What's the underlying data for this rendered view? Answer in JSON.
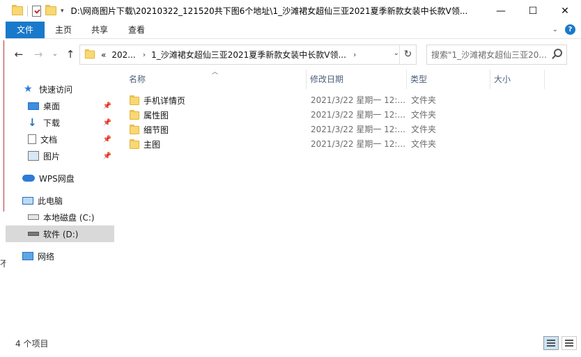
{
  "window": {
    "title_path": "D:\\网商图片下载\\20210322_121520共下图6个地址\\1_沙滩裙女超仙三亚2021夏季新款女装中长款V领...",
    "controls": {
      "minimize": "—",
      "maximize": "☐",
      "close": "✕"
    }
  },
  "ribbon": {
    "tabs": [
      "文件",
      "主页",
      "共享",
      "查看"
    ]
  },
  "address": {
    "overflow": "«",
    "crumb1": "202...",
    "crumb2": "1_沙滩裙女超仙三亚2021夏季新款女装中长款V领...",
    "sep": "›"
  },
  "search": {
    "placeholder": "搜索\"1_沙滩裙女超仙三亚20..."
  },
  "nav": {
    "quick_access": "快速访问",
    "items": [
      {
        "label": "桌面",
        "icon": "desktop-icon"
      },
      {
        "label": "下载",
        "icon": "download-icon"
      },
      {
        "label": "文档",
        "icon": "documents-icon"
      },
      {
        "label": "图片",
        "icon": "pictures-icon"
      }
    ],
    "wps": "WPS网盘",
    "this_pc": "此电脑",
    "drive_c": "本地磁盘 (C:)",
    "drive_d": "软件 (D:)",
    "network": "网络"
  },
  "columns": {
    "name": "名称",
    "date": "修改日期",
    "type": "类型",
    "size": "大小"
  },
  "files": [
    {
      "name": "手机详情页",
      "date": "2021/3/22 星期一 12:...",
      "type": "文件夹"
    },
    {
      "name": "属性图",
      "date": "2021/3/22 星期一 12:...",
      "type": "文件夹"
    },
    {
      "name": "细节图",
      "date": "2021/3/22 星期一 12:...",
      "type": "文件夹"
    },
    {
      "name": "主图",
      "date": "2021/3/22 星期一 12:...",
      "type": "文件夹"
    }
  ],
  "status": {
    "count": "4 个项目"
  },
  "background_fragment": "不"
}
